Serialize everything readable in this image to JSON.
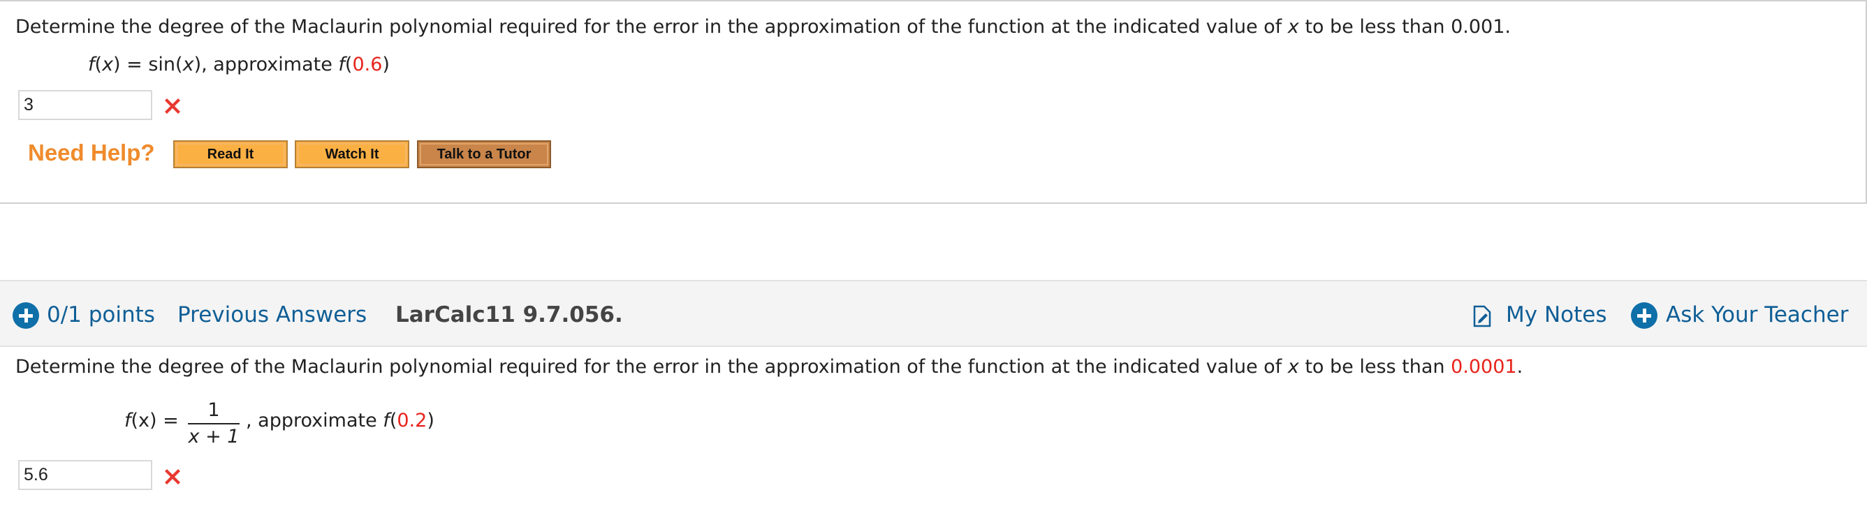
{
  "question1": {
    "prompt_prefix": "Determine the degree of the Maclaurin polynomial required for the error in the approximation of the function at the indicated value of ",
    "prompt_var": "x",
    "prompt_suffix": " to be less than 0.001.",
    "fn_prefix": "f",
    "fn_mid1": "(",
    "fn_var": "x",
    "fn_mid2": ") = sin(",
    "fn_var2": "x",
    "fn_mid3": "), approximate ",
    "fn_f": "f",
    "fn_open": "(",
    "fn_point": "0.6",
    "fn_close": ")",
    "answer_value": "3",
    "answer_status": "incorrect",
    "need_help_label": "Need Help?",
    "read_it_label": "Read It",
    "watch_it_label": "Watch It",
    "tutor_label": "Talk to a Tutor"
  },
  "question2_header": {
    "points": "0/1 points",
    "previous_answers": "Previous Answers",
    "assignment_id": "LarCalc11 9.7.056.",
    "my_notes": "My Notes",
    "ask_teacher": "Ask Your Teacher"
  },
  "question2": {
    "prompt_prefix": "Determine the degree of the Maclaurin polynomial required for the error in the approximation of the function at the indicated value of ",
    "prompt_var": "x",
    "prompt_mid": " to be less than ",
    "prompt_threshold": "0.0001",
    "prompt_end": ".",
    "fn_lhs_f": "f",
    "fn_lhs_rest": "(x) =",
    "frac_numerator": "1",
    "frac_denominator": "x + 1",
    "fn_after": ", approximate ",
    "fn_f": "f",
    "fn_open": "(",
    "fn_point": "0.2",
    "fn_close": ")",
    "answer_value": "5.6",
    "answer_status": "incorrect"
  },
  "colors": {
    "accent_blue": "#0f6fa8",
    "error_red": "#e8231c",
    "help_orange": "#ef8b2c",
    "button_orange": "#fbb044"
  },
  "icons": {
    "incorrect": "close-x-icon",
    "points": "plus-circle-icon",
    "notes": "notes-edit-icon",
    "teacher": "plus-circle-icon"
  }
}
